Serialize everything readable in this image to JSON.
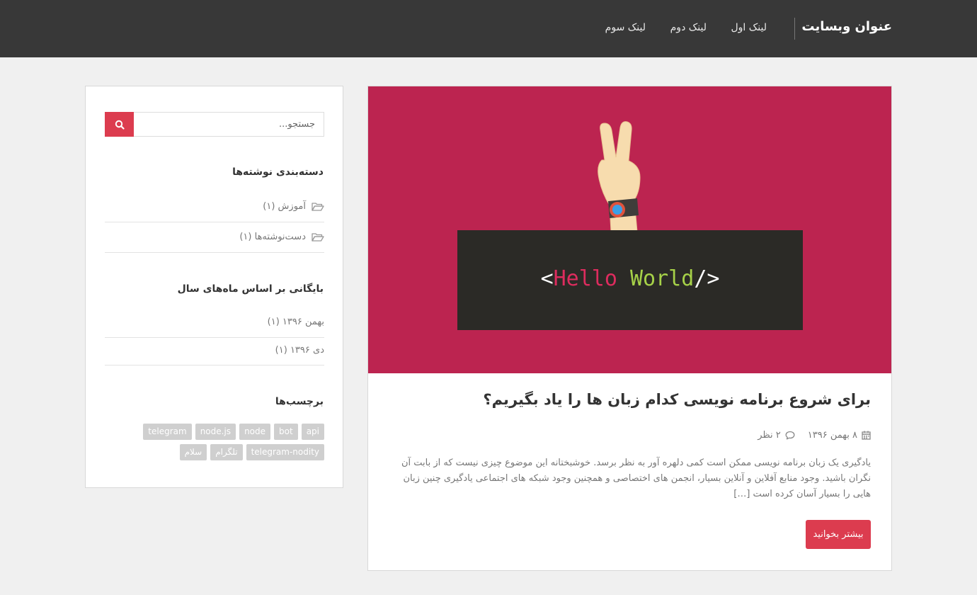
{
  "navbar": {
    "brand": "عنوان وبسایت",
    "links": [
      "لینک اول",
      "لینک دوم",
      "لینک سوم"
    ]
  },
  "sidebar": {
    "search": {
      "placeholder": "جستجو...",
      "button_icon": "search-icon"
    },
    "categories": {
      "title": "دسته‌بندی نوشته‌ها",
      "items": [
        {
          "label": "آموزش (۱)",
          "icon": "folder-open-icon"
        },
        {
          "label": "دست‌نوشته‌ها (۱)",
          "icon": "folder-open-icon"
        }
      ]
    },
    "archives": {
      "title": "بایگانی بر اساس ماه‌های سال",
      "items": [
        "بهمن ۱۳۹۶ (۱)",
        "دی ۱۳۹۶ (۱)"
      ]
    },
    "tags": {
      "title": "برچسب‌ها",
      "row1": [
        "api",
        "bot",
        "node",
        "node.js",
        "telegram"
      ],
      "row2": [
        "سلام",
        "تلگرام",
        "telegram-nodity"
      ]
    }
  },
  "post": {
    "image_text": {
      "open": "<",
      "hello": "Hello",
      "world": "World",
      "close": "/>"
    },
    "title": "برای شروع برنامه نویسی کدام زبان ها را یاد بگیریم؟",
    "date": "۸ بهمن ۱۳۹۶",
    "comments": "۲ نظر",
    "excerpt": "یادگیری یک زبان برنامه نویسی ممکن است کمی دلهره آور به نظر برسد. خوشبختانه این موضوع چیزی نیست که از بابت آن نگران باشید. وجود منابع آفلاین و آنلاین بسیار، انجمن های اختصاصی و همچنین وجود شبکه های اجتماعی یادگیری چنین زبان هایی را بسیار آسان کرده است […]",
    "read_more": "بیشتر بخوانید"
  },
  "colors": {
    "navbar": "#383838",
    "accent": "#dc3c4f",
    "hero_bg": "#bc2450",
    "code_box": "#2b2a26",
    "hello": "#dd2c5e",
    "world": "#a6d148"
  }
}
